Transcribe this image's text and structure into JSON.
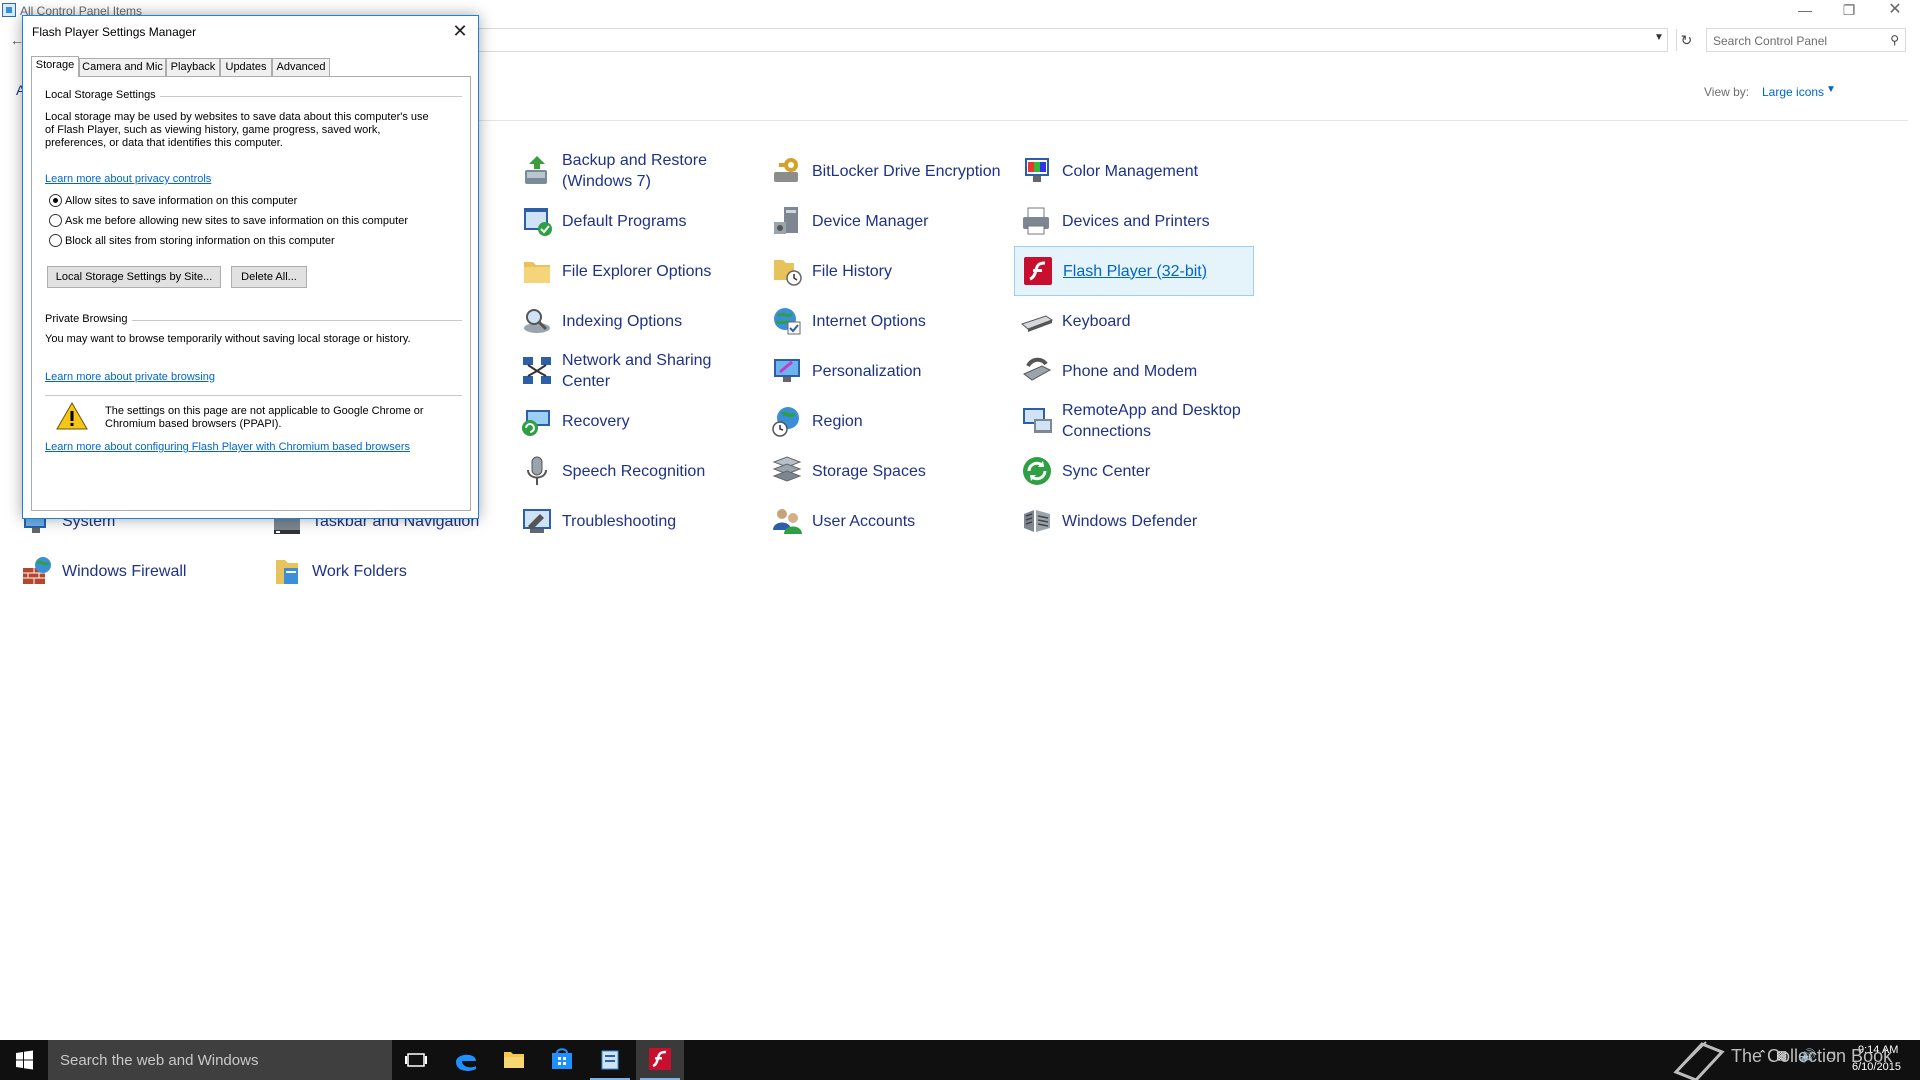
{
  "window": {
    "title": "All Control Panel Items",
    "header_fragment": "A"
  },
  "search": {
    "placeholder": "Search Control Panel"
  },
  "view_by": {
    "label": "View by:",
    "value": "Large icons"
  },
  "items": [
    {
      "label": "Backup and Restore (Windows 7)",
      "icon": "backup-icon",
      "selected": false
    },
    {
      "label": "BitLocker Drive Encryption",
      "icon": "bitlocker-icon",
      "selected": false
    },
    {
      "label": "Color Management",
      "icon": "color-management-icon",
      "selected": false
    },
    {
      "label": "Default Programs",
      "icon": "default-programs-icon",
      "selected": false
    },
    {
      "label": "Device Manager",
      "icon": "device-manager-icon",
      "selected": false
    },
    {
      "label": "Devices and Printers",
      "icon": "printer-icon",
      "selected": false
    },
    {
      "label": "File Explorer Options",
      "icon": "folder-options-icon",
      "selected": false
    },
    {
      "label": "File History",
      "icon": "file-history-icon",
      "selected": false
    },
    {
      "label": "Flash Player (32-bit)",
      "icon": "flash-icon",
      "selected": true
    },
    {
      "label": "Indexing Options",
      "icon": "indexing-icon",
      "selected": false
    },
    {
      "label": "Internet Options",
      "icon": "internet-options-icon",
      "selected": false
    },
    {
      "label": "Keyboard",
      "icon": "keyboard-icon",
      "selected": false
    },
    {
      "label": "Network and Sharing Center",
      "icon": "network-icon",
      "selected": false
    },
    {
      "label": "Personalization",
      "icon": "personalization-icon",
      "selected": false
    },
    {
      "label": "Phone and Modem",
      "icon": "phone-icon",
      "selected": false
    },
    {
      "label": "Recovery",
      "icon": "recovery-icon",
      "selected": false
    },
    {
      "label": "Region",
      "icon": "region-icon",
      "selected": false
    },
    {
      "label": "RemoteApp and Desktop Connections",
      "icon": "remoteapp-icon",
      "selected": false
    },
    {
      "label": "Speech Recognition",
      "icon": "microphone-icon",
      "selected": false
    },
    {
      "label": "Storage Spaces",
      "icon": "storage-icon",
      "selected": false
    },
    {
      "label": "Sync Center",
      "icon": "sync-icon",
      "selected": false
    },
    {
      "label": "System",
      "icon": "system-icon",
      "selected": false
    },
    {
      "label": "Taskbar and Navigation",
      "icon": "taskbar-icon",
      "selected": false
    },
    {
      "label": "Troubleshooting",
      "icon": "troubleshooting-icon",
      "selected": false
    },
    {
      "label": "User Accounts",
      "icon": "users-icon",
      "selected": false
    },
    {
      "label": "Windows Defender",
      "icon": "defender-icon",
      "selected": false
    },
    {
      "label": "Windows Firewall",
      "icon": "firewall-icon",
      "selected": false
    },
    {
      "label": "Work Folders",
      "icon": "work-folders-icon",
      "selected": false
    }
  ],
  "dialog": {
    "title": "Flash Player Settings Manager",
    "tabs": [
      {
        "label": "Storage",
        "active": true
      },
      {
        "label": "Camera and Mic",
        "active": false
      },
      {
        "label": "Playback",
        "active": false
      },
      {
        "label": "Updates",
        "active": false
      },
      {
        "label": "Advanced",
        "active": false
      }
    ],
    "local_storage": {
      "heading": "Local Storage Settings",
      "description": [
        "Local storage may be used by websites to save data about this computer's use",
        "of Flash Player, such as viewing history, game progress, saved work,",
        "preferences, or data that identifies this computer."
      ],
      "privacy_link": "Learn more about privacy controls",
      "options": [
        {
          "label": "Allow sites to save information on this computer",
          "checked": true
        },
        {
          "label": "Ask me before allowing new sites to save information on this computer",
          "checked": false
        },
        {
          "label": "Block all sites from storing information on this computer",
          "checked": false
        }
      ],
      "by_site_button": "Local Storage Settings by Site...",
      "delete_all_button": "Delete All..."
    },
    "private_browsing": {
      "heading": "Private Browsing",
      "description": "You may want to browse temporarily without saving local storage or history.",
      "link": "Learn more about private browsing"
    },
    "notice": {
      "lines": [
        "The settings on this page are not applicable to Google Chrome or",
        "Chromium based browsers (PPAPI)."
      ],
      "link": "Learn more about configuring Flash Player with Chromium based browsers"
    }
  },
  "taskbar": {
    "search_text": "Search the web and Windows",
    "time": "9:14 AM",
    "date": "6/10/2015",
    "watermark": "The Collection Book"
  }
}
